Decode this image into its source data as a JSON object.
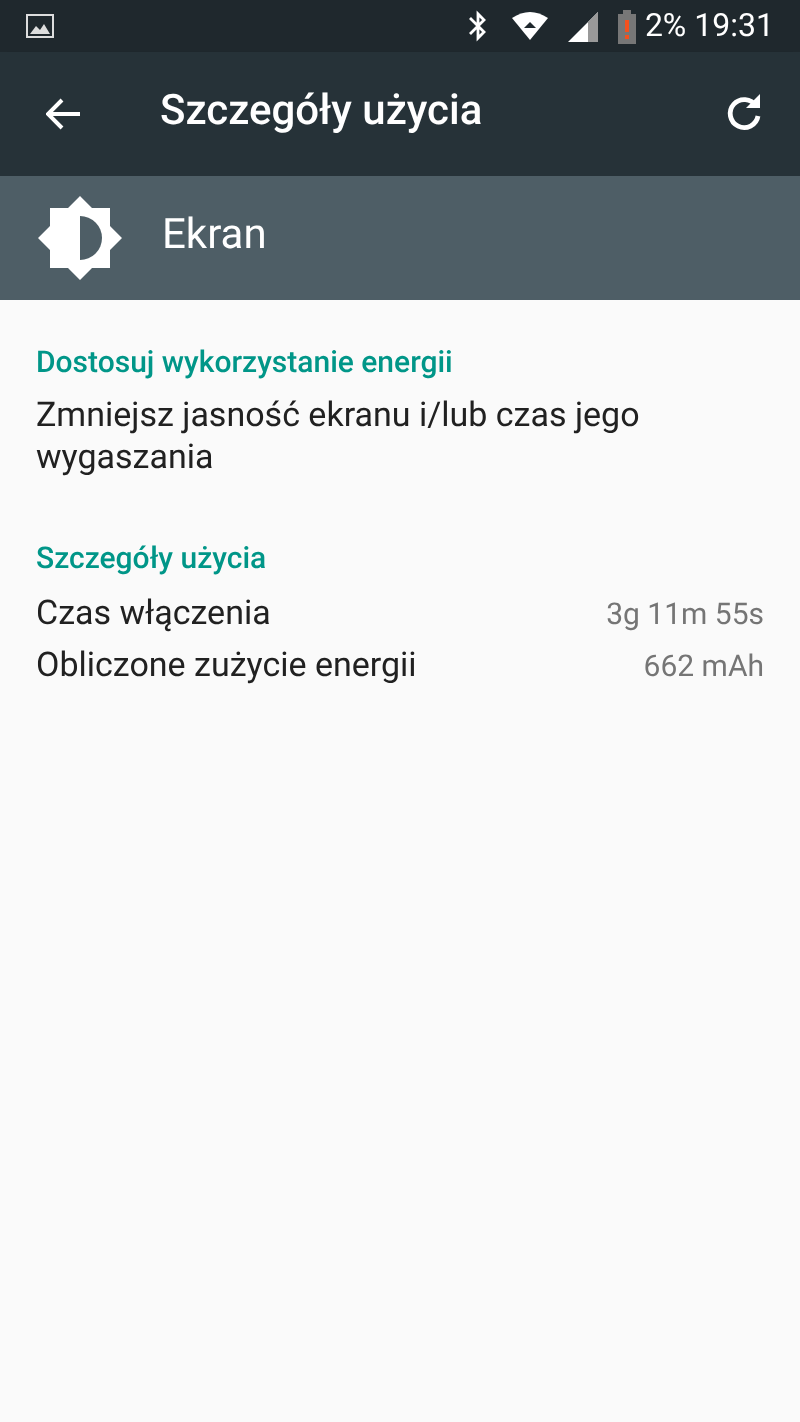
{
  "status_bar": {
    "battery_percent": "2%",
    "time": "19:31"
  },
  "toolbar": {
    "title": "Szczegóły użycia"
  },
  "app_header": {
    "name": "Ekran"
  },
  "sections": [
    {
      "kind": "action",
      "title": "Dostosuj wykorzystanie energii",
      "text": "Zmniejsz jasność ekranu i/lub czas jego wygaszania"
    },
    {
      "kind": "details",
      "title": "Szczegóły użycia",
      "rows": [
        {
          "label": "Czas włączenia",
          "value": "3g 11m 55s"
        },
        {
          "label": "Obliczone zużycie energii",
          "value": "662 mAh"
        }
      ]
    }
  ]
}
